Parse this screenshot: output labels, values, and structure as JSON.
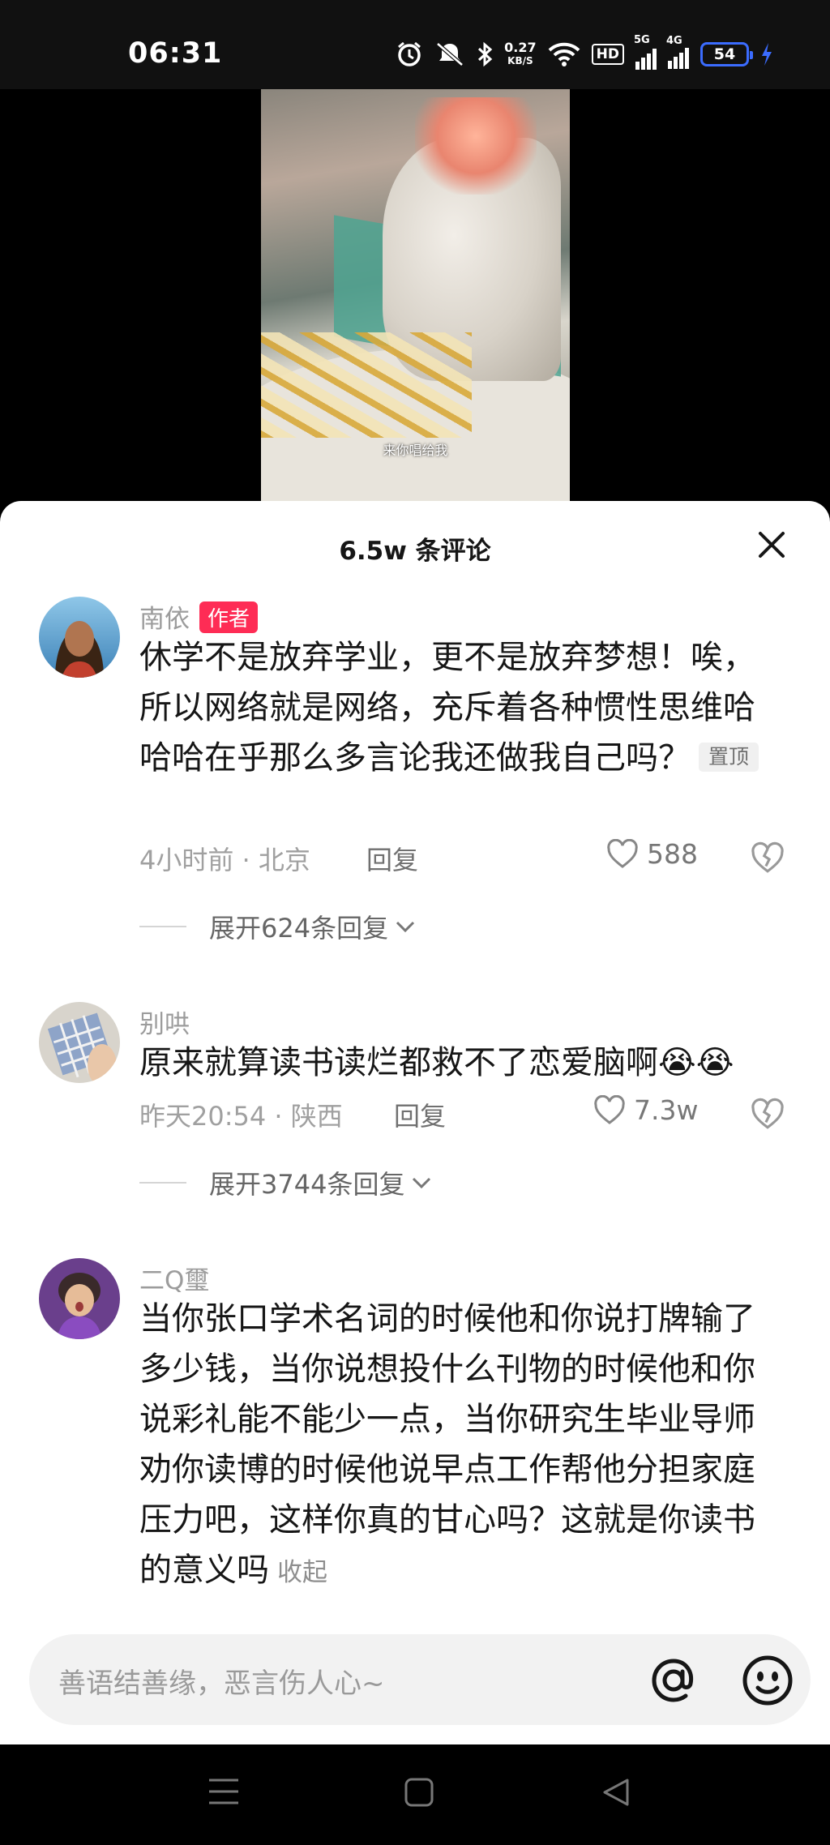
{
  "status_bar": {
    "time": "06:31",
    "net_speed_value": "0.27",
    "net_speed_unit": "KB/S",
    "hd_label": "HD",
    "signal1_label": "5G",
    "signal2_label": "4G",
    "battery": "54",
    "icons": [
      "alarm-icon",
      "mute-icon",
      "bluetooth-icon",
      "wifi-icon",
      "charging-icon"
    ]
  },
  "video": {
    "caption": "来你唱给我"
  },
  "comments_panel": {
    "title": "6.5w 条评论",
    "close_icon": "close-icon"
  },
  "comments": [
    {
      "username": "南依",
      "author_tag": "作者",
      "text": "休学不是放弃学业，更不是放弃梦想！唉，所以网络就是网络，充斥着各种惯性思维哈哈哈在乎那么多言论我还做我自己吗？",
      "pin_tag": "置顶",
      "meta": "4小时前 · 北京",
      "reply": "回复",
      "likes": "588",
      "expand": "展开624条回复"
    },
    {
      "username": "别哄",
      "text": "原来就算读书读烂都救不了恋爱脑啊😭😭",
      "meta": "昨天20:54 · 陕西",
      "reply": "回复",
      "likes": "7.3w",
      "expand": "展开3744条回复"
    },
    {
      "username": "二Q璽",
      "text": "当你张口学术名词的时候他和你说打牌输了多少钱，当你说想投什么刊物的时候他和你说彩礼能不能少一点，当你研究生毕业导师劝你读博的时候他说早点工作帮他分担家庭压力吧，这样你真的甘心吗？这就是你读书的意义吗",
      "collapse": "收起"
    }
  ],
  "input": {
    "placeholder": "善语结善缘，恶言伤人心~",
    "at_icon": "at-icon",
    "emoji_icon": "emoji-icon"
  },
  "nav": [
    "menu-icon",
    "home-icon",
    "back-icon"
  ]
}
